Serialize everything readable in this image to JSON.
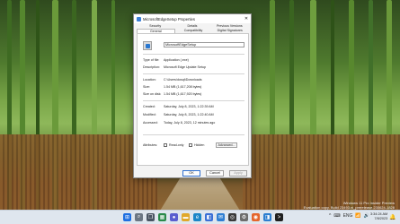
{
  "window": {
    "title": "MicrosoftEdgeSetup Properties",
    "close_glyph": "✕"
  },
  "tabs": {
    "row1": [
      "Security",
      "Details",
      "Previous Versions"
    ],
    "row2": [
      "General",
      "Compatibility",
      "Digital Signatures"
    ],
    "active": "General"
  },
  "general": {
    "file_name": "MicrosoftEdgeSetup",
    "type_label": "Type of file:",
    "type_value": "Application (.exe)",
    "desc_label": "Description:",
    "desc_value": "Microsoft Edge Update Setup",
    "location_label": "Location:",
    "location_value": "C:\\Users\\dosqt\\Downloads",
    "size_label": "Size:",
    "size_value": "1.54 MB (1,617,208 bytes)",
    "size_disk_label": "Size on disk:",
    "size_disk_value": "1.54 MB (1,617,920 bytes)",
    "created_label": "Created:",
    "created_value": "Saturday, July 8, 2023, 1:22:39 AM",
    "modified_label": "Modified:",
    "modified_value": "Saturday, July 8, 2023, 1:22:40 AM",
    "accessed_label": "Accessed:",
    "accessed_value": "Today, July 8, 2023, 12 minutes ago",
    "attributes_label": "Attributes:",
    "readonly_label": "Read-only",
    "hidden_label": "Hidden",
    "advanced_label": "Advanced..."
  },
  "buttons": {
    "ok": "OK",
    "cancel": "Cancel",
    "apply": "Apply"
  },
  "watermark": {
    "line1": "Windows 11 Pro Insider Preview",
    "line2": "Evaluation copy. Build 23493.ni_prerelease.230624-1828"
  },
  "taskbar": {
    "time": "3:34:24 AM",
    "date": "7/8/2023",
    "tray_glyphs": [
      "^",
      "⌨",
      "ENG",
      "📶",
      "🔊"
    ],
    "apps": [
      {
        "name": "start",
        "color": "#1f6fe0",
        "glyph": "⊞"
      },
      {
        "name": "search",
        "color": "#6b7683",
        "glyph": "⌕"
      },
      {
        "name": "task-view",
        "color": "#4a5563",
        "glyph": "❐"
      },
      {
        "name": "widgets",
        "color": "#2b8a4a",
        "glyph": "▦"
      },
      {
        "name": "chat",
        "color": "#5a5fcf",
        "glyph": "●"
      },
      {
        "name": "file-explorer",
        "color": "#e0a82a",
        "glyph": "▬"
      },
      {
        "name": "edge",
        "color": "#1b86c8",
        "glyph": "e"
      },
      {
        "name": "store",
        "color": "#3a6fd6",
        "glyph": "◧"
      },
      {
        "name": "mail",
        "color": "#2f7fd3",
        "glyph": "✉"
      },
      {
        "name": "camera",
        "color": "#3a3a3a",
        "glyph": "◎"
      },
      {
        "name": "settings",
        "color": "#6d6d6d",
        "glyph": "⚙"
      },
      {
        "name": "firefox",
        "color": "#e5662c",
        "glyph": "◉"
      },
      {
        "name": "store-2",
        "color": "#2c7ed0",
        "glyph": "◨"
      },
      {
        "name": "terminal",
        "color": "#1f1f1f",
        "glyph": ">"
      }
    ]
  }
}
